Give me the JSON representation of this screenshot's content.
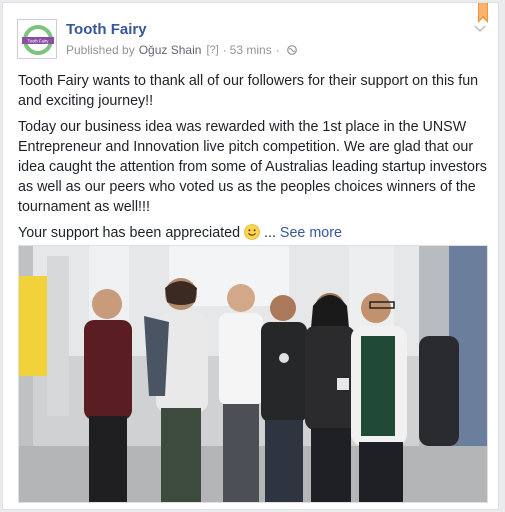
{
  "post": {
    "page_name": "Tooth Fairy",
    "published_by_prefix": "Published by",
    "author": "Oğuz Shain",
    "help_marker": "[?]",
    "time": "53 mins",
    "separator": "·",
    "avatar_logo_text": "Tooth Fairy",
    "icons": [
      "bookmark-icon",
      "chevron-down-icon",
      "globe-icon",
      "smile-emoji-icon"
    ],
    "body": {
      "p1": "Tooth Fairy wants to thank all of our followers for their support on this fun and exciting journey!!",
      "p2": "Today our business idea was rewarded with the 1st place in the UNSW Entrepreneur and Innovation live pitch competition. We are glad that our idea caught the attention from some of Australias leading startup investors as well as our peers who voted us as the peoples choices winners of the tournament as well!!!",
      "p3": "Your support has been appreciated",
      "ellipsis": "...",
      "see_more": "See more"
    }
  }
}
